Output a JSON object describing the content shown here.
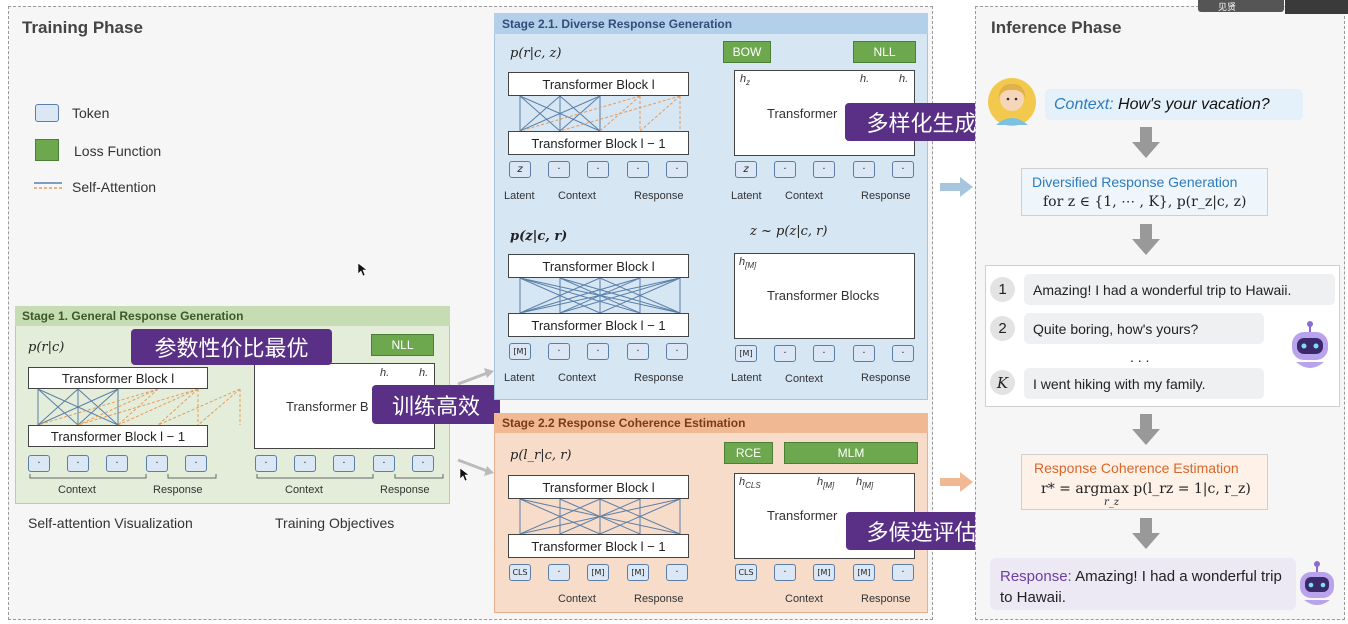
{
  "training": {
    "title": "Training Phase",
    "legend": {
      "token": "Token",
      "loss": "Loss Function",
      "attn": "Self-Attention"
    },
    "stage1": {
      "title": "Stage 1. General Response Generation",
      "formula": "p(r|c)",
      "block_top": "Transformer Block l",
      "block_bottom": "Transformer Block l − 1",
      "transformer": "Transformer B",
      "nll": "NLL",
      "h1": "h.",
      "h2": "h.",
      "context": "Context",
      "response": "Response",
      "context2": "Context",
      "response2": "Response",
      "caption_left": "Self-attention Visualization",
      "caption_right": "Training Objectives",
      "bubble1": "参数性价比最优",
      "bubble2": "训练高效"
    },
    "stage21": {
      "title": "Stage 2.1. Diverse Response Generation",
      "formula1": "p(r|c, z)",
      "formula2": "p(z|c, r)",
      "block_top": "Transformer Block l",
      "block_bottom": "Transformer Block l − 1",
      "block_top2": "Transformer Block l",
      "block_bottom2": "Transformer Block l − 1",
      "transformer": "Transformer",
      "transformer_blocks": "Transformer Blocks",
      "bow": "BOW",
      "nll": "NLL",
      "hz": "h",
      "hz_sub": "z",
      "h1": "h.",
      "h2": "h.",
      "hm": "h",
      "hm_sub": "[M]",
      "sample": "z ~ p(z|c, r)",
      "z": "z",
      "m": "[M]",
      "latent": "Latent",
      "context": "Context",
      "response": "Response",
      "bubble": "多样化生成"
    },
    "stage22": {
      "title": "Stage 2.2 Response Coherence Estimation",
      "formula": "p(l_r|c, r)",
      "block_top": "Transformer Block l",
      "block_bottom": "Transformer Block l − 1",
      "transformer": "Transformer",
      "rce": "RCE",
      "mlm": "MLM",
      "hcls": "h",
      "hcls_sub": "CLS",
      "hm1": "h",
      "hm1_sub": "[M]",
      "hm2": "h",
      "hm2_sub": "[M]",
      "cls": "CLS",
      "m": "[M]",
      "context": "Context",
      "response": "Response",
      "bubble": "多候选评估"
    }
  },
  "inference": {
    "title": "Inference Phase",
    "context_label": "Context:",
    "context_text": "How's your vacation?",
    "diversified_title": "Diversified Response Generation",
    "diversified_formula": "for z ∈ {1, ⋯ , K},   p(r_z|c, z)",
    "responses": [
      {
        "num": "1",
        "text": "Amazing! I had a wonderful trip to Hawaii."
      },
      {
        "num": "2",
        "text": "Quite boring, how's yours?"
      },
      {
        "num": "K",
        "text": "I went hiking with my family."
      }
    ],
    "ellipsis": ". . .",
    "coherence_title": "Response Coherence Estimation",
    "coherence_formula": "r* = argmax p(l_rz = 1|c, r_z)",
    "coherence_sub": "r_z",
    "final_label": "Response:",
    "final_text": "Amazing! I had a wonderful trip to Hawaii.",
    "user_tag": "见贤"
  },
  "colors": {
    "token_fill": "#dbe7f5",
    "loss_green": "#6ea84e",
    "stage1_bg": "#e3edd9",
    "stage21_bg": "#d6e6f3",
    "stage22_bg": "#f7dcca",
    "bubble": "#5a2f86",
    "context_blue": "#2e7bbd",
    "coherence_orange": "#d9662a"
  }
}
